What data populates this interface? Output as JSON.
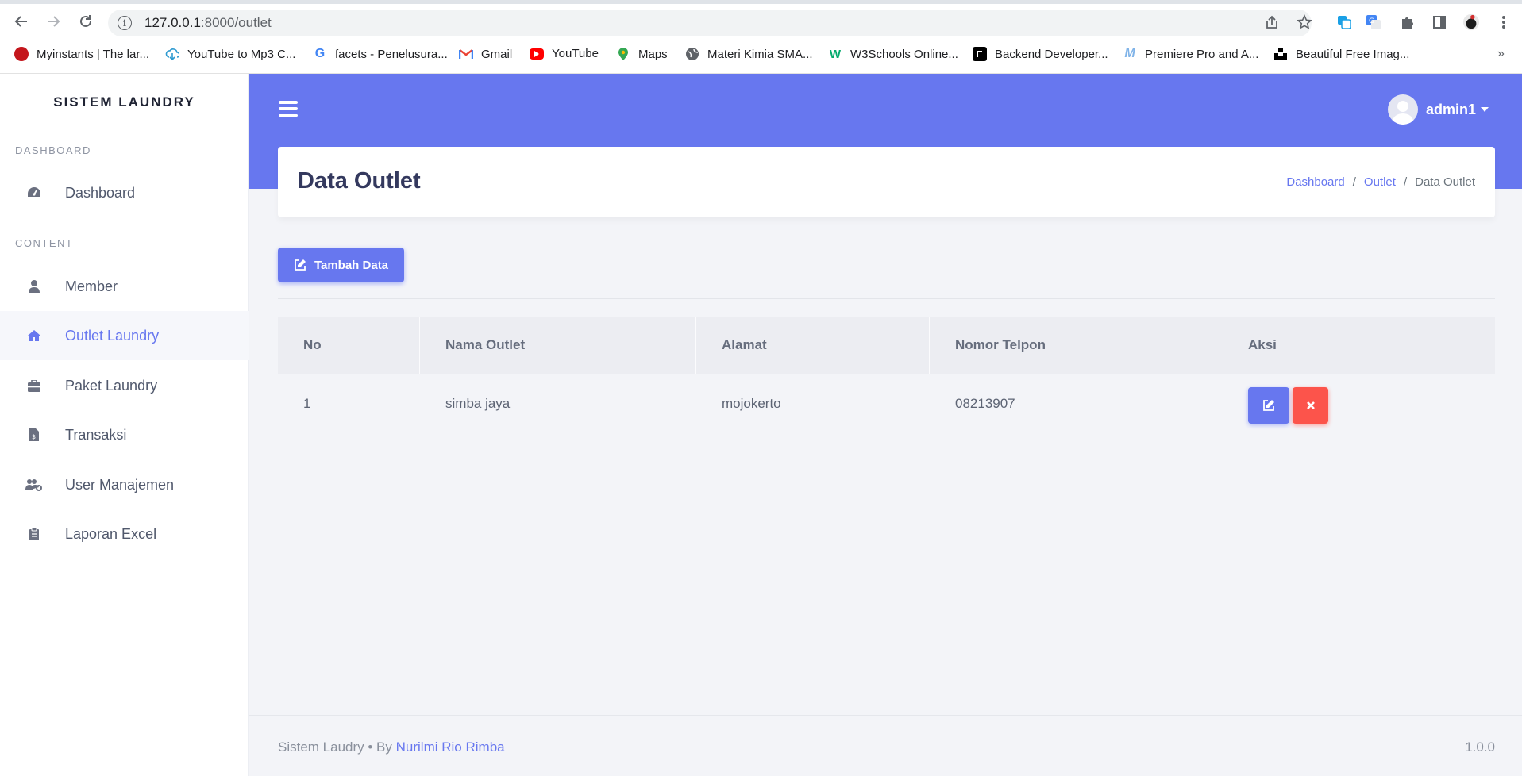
{
  "browser": {
    "url_host": "127.0.0.1",
    "url_path": ":8000/outlet",
    "bookmarks": [
      {
        "label": "Myinstants | The lar...",
        "icon": "myinstants-icon",
        "color": "#c4161c"
      },
      {
        "label": "YouTube to Mp3 C...",
        "icon": "download-cloud-icon",
        "color": "#2e9ad0"
      },
      {
        "label": "facets - Penelusura...",
        "icon": "google-icon",
        "color": "#4285f4"
      },
      {
        "label": "Gmail",
        "icon": "gmail-icon",
        "color": "#ea4335"
      },
      {
        "label": "YouTube",
        "icon": "youtube-icon",
        "color": "#ff0000"
      },
      {
        "label": "Maps",
        "icon": "maps-icon",
        "color": "#34a853"
      },
      {
        "label": "Materi Kimia SMA...",
        "icon": "globe-icon",
        "color": "#5f6368"
      },
      {
        "label": "W3Schools Online...",
        "icon": "w3schools-icon",
        "color": "#04aa6d"
      },
      {
        "label": "Backend Developer...",
        "icon": "roadmap-icon",
        "color": "#000000"
      },
      {
        "label": "Premiere Pro and A...",
        "icon": "premiere-icon",
        "color": "#7fb3e8"
      },
      {
        "label": "Beautiful Free Imag...",
        "icon": "unsplash-icon",
        "color": "#000000"
      }
    ]
  },
  "sidebar": {
    "brand": "SISTEM LAUNDRY",
    "section_dashboard": "DASHBOARD",
    "section_content": "CONTENT",
    "items": [
      {
        "label": "Dashboard",
        "icon": "speedometer-icon"
      },
      {
        "label": "Member",
        "icon": "user-icon"
      },
      {
        "label": "Outlet Laundry",
        "icon": "home-icon",
        "active": true
      },
      {
        "label": "Paket Laundry",
        "icon": "briefcase-icon"
      },
      {
        "label": "Transaksi",
        "icon": "invoice-icon"
      },
      {
        "label": "User Manajemen",
        "icon": "users-cog-icon"
      },
      {
        "label": "Laporan Excel",
        "icon": "clipboard-icon"
      }
    ]
  },
  "topbar": {
    "username": "admin1"
  },
  "page": {
    "title": "Data Outlet",
    "breadcrumb": [
      "Dashboard",
      "Outlet",
      "Data Outlet"
    ],
    "add_button": "Tambah Data"
  },
  "table": {
    "headers": [
      "No",
      "Nama Outlet",
      "Alamat",
      "Nomor Telpon",
      "Aksi"
    ],
    "rows": [
      {
        "no": "1",
        "nama": "simba jaya",
        "alamat": "mojokerto",
        "telpon": "08213907"
      }
    ]
  },
  "footer": {
    "text": "Sistem Laudry • By",
    "author": "Nurilmi Rio Rimba",
    "version": "1.0.0"
  },
  "colors": {
    "primary": "#6777ef",
    "danger": "#fc544b"
  }
}
